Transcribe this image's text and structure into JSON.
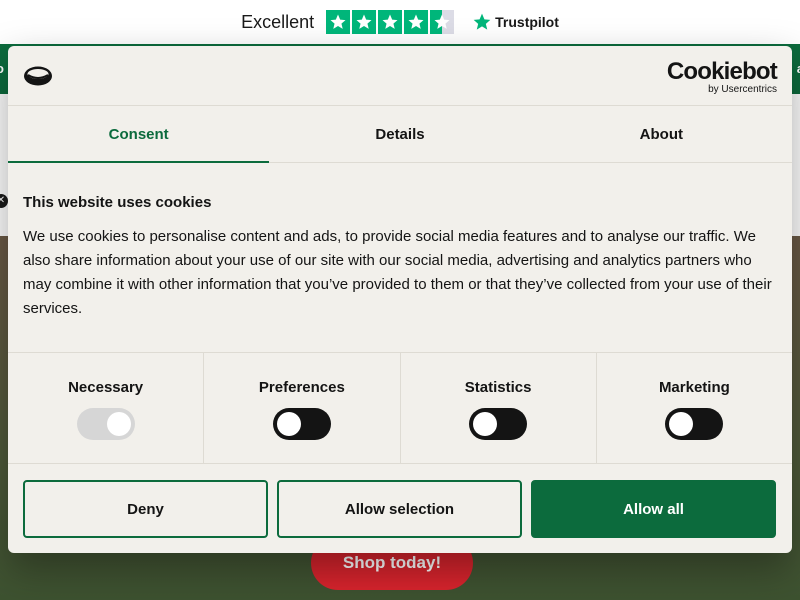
{
  "trustpilot": {
    "rating_text": "Excellent",
    "stars_full": 4,
    "stars_half": 1,
    "brand": "Trustpilot",
    "star_color": "#00b67a"
  },
  "page": {
    "brand_color": "#0c6b3d",
    "shop_button_label": "Shop today!",
    "shop_button_color": "#d8242d"
  },
  "cookie_dialog": {
    "brand_name": "Cookiebot",
    "brand_sub": "by Usercentrics",
    "tabs": [
      {
        "label": "Consent",
        "active": true
      },
      {
        "label": "Details",
        "active": false
      },
      {
        "label": "About",
        "active": false
      }
    ],
    "title": "This website uses cookies",
    "description": "We use cookies to personalise content and ads, to provide social media features and to analyse our traffic. We also share information about your use of our site with our social media, advertising and analytics partners who may combine it with other information that you’ve provided to them or that they’ve collected from your use of their services.",
    "categories": [
      {
        "label": "Necessary",
        "enabled": true,
        "locked": true
      },
      {
        "label": "Preferences",
        "enabled": false,
        "locked": false
      },
      {
        "label": "Statistics",
        "enabled": false,
        "locked": false
      },
      {
        "label": "Marketing",
        "enabled": false,
        "locked": false
      }
    ],
    "buttons": {
      "deny": "Deny",
      "allow_selection": "Allow selection",
      "allow_all": "Allow all"
    }
  }
}
